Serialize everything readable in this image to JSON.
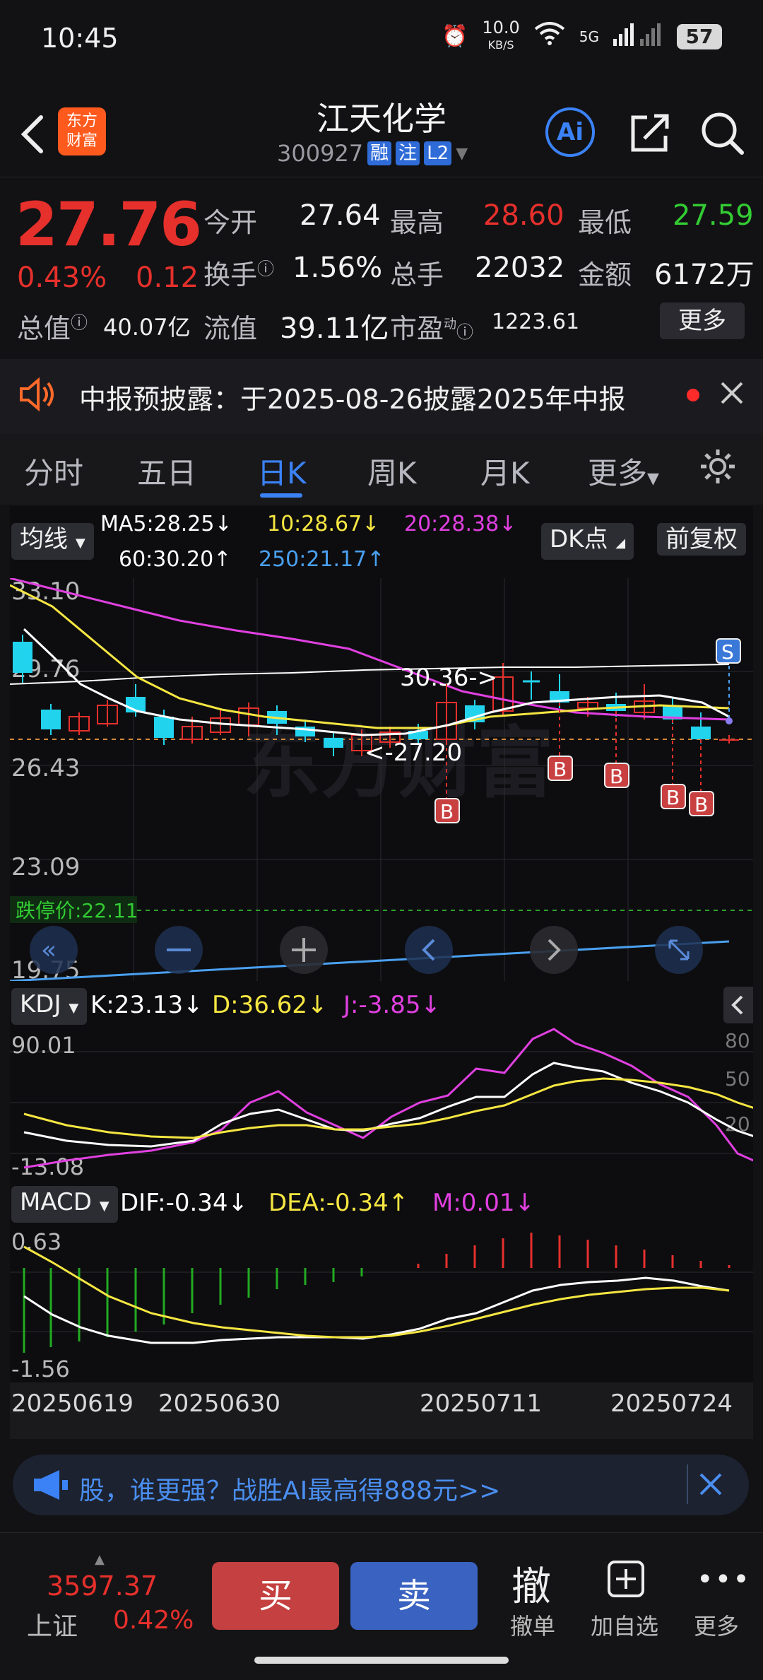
{
  "status": {
    "time": "10:45",
    "net_speed": "10.0",
    "net_unit": "KB/S",
    "signal": "5G",
    "battery": "57"
  },
  "header": {
    "logo_top": "东方",
    "logo_bottom": "财富",
    "title": "江天化学",
    "code": "300927",
    "tags": [
      "融",
      "注",
      "L2"
    ],
    "ai": "Ai"
  },
  "quote": {
    "price": "27.76",
    "pct": "0.43%",
    "change": "0.12",
    "open_label": "今开",
    "open": "27.64",
    "high_label": "最高",
    "high": "28.60",
    "low_label": "最低",
    "low": "27.59",
    "turnover_label": "换手",
    "turnover": "1.56%",
    "volume_label": "总手",
    "volume": "22032",
    "amount_label": "金额",
    "amount": "6172万",
    "mktcap_label": "总值",
    "mktcap": "40.07亿",
    "float_label": "流值",
    "float": "39.11亿",
    "pe_label": "市盈",
    "pe_sup": "动",
    "pe": "1223.61",
    "more": "更多"
  },
  "notice": {
    "text": "中报预披露：于2025-08-26披露2025年中报"
  },
  "tabs": [
    "分时",
    "五日",
    "日K",
    "周K",
    "月K",
    "更多"
  ],
  "active_tab": "日K",
  "kline": {
    "selector": "均线",
    "ma5": "MA5:28.25↓",
    "ma10": "10:28.67↓",
    "ma20": "20:28.38↓",
    "ma60": "60:30.20↑",
    "ma250": "250:21.17↑",
    "dk": "DK点",
    "adjust": "前复权",
    "y_ticks": [
      "33.10",
      "29.76",
      "26.43",
      "23.09",
      "19.75"
    ],
    "high_mark": "30.36->",
    "low_mark": "<-27.20",
    "limit_down": "跌停价:22.11",
    "watermark": "东方财富",
    "signals": [
      "B",
      "B",
      "B",
      "B",
      "B",
      "S"
    ]
  },
  "kdj": {
    "selector": "KDJ",
    "k": "K:23.13↓",
    "d": "D:36.62↓",
    "j": "J:-3.85↓",
    "y_top": "90.01",
    "y_bottom": "-13.08",
    "right_ticks": [
      "80",
      "50",
      "20"
    ]
  },
  "macd": {
    "selector": "MACD",
    "dif": "DIF:-0.34↓",
    "dea": "DEA:-0.34↑",
    "m": "M:0.01↓",
    "y_top": "0.63",
    "y_bottom": "-1.56"
  },
  "x_dates": [
    "20250619",
    "20250630",
    "20250711",
    "20250724"
  ],
  "banner": {
    "text": "股，谁更强？战胜AI最高得888元>>"
  },
  "bottom": {
    "index_value": "3597.37",
    "index_name": "上证",
    "index_pct": "0.42%",
    "buy": "买",
    "sell": "卖",
    "cancel_glyph": "撤",
    "cancel": "撤单",
    "watch": "加自选",
    "more": "更多"
  },
  "colors": {
    "up": "#e6302c",
    "down": "#33cc33",
    "accent": "#3b82f6",
    "ma5": "#ffffff",
    "ma10": "#f5e642",
    "ma20": "#e040e0",
    "ma60": "#ffffff",
    "ma250": "#4aa0f0"
  }
}
